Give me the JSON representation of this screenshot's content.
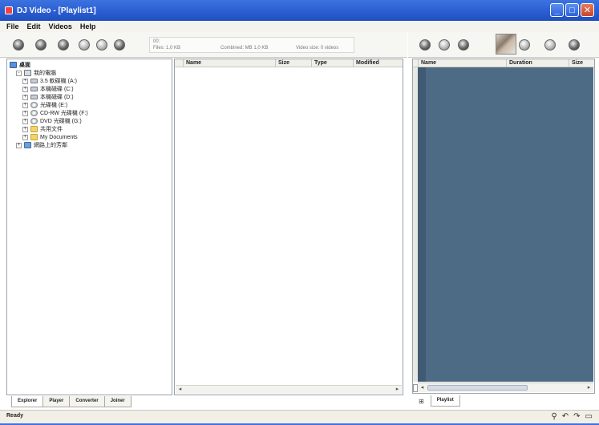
{
  "window": {
    "title": "DJ Video - [Playlist1]",
    "controls": {
      "minimize": "_",
      "maximize": "□",
      "close": "✕"
    }
  },
  "menu": [
    "File",
    "Edit",
    "Videos",
    "Help"
  ],
  "status_panel": {
    "line1": "00:",
    "line2": "Files: 1,0 KB",
    "line3": "Combined: MB 1,0 KB",
    "line4": "Video size: 0 videos"
  },
  "tree": [
    {
      "label": "桌面",
      "icon": "desktop-icon",
      "indent": 0,
      "expander": ""
    },
    {
      "label": "我的電腦",
      "icon": "computer-icon",
      "indent": 1,
      "expander": "-"
    },
    {
      "label": "3.5 軟碟機 (A:)",
      "icon": "floppy-icon",
      "indent": 2,
      "expander": "+"
    },
    {
      "label": "本機磁碟 (C:)",
      "icon": "drive-icon",
      "indent": 2,
      "expander": "+"
    },
    {
      "label": "本機磁碟 (D:)",
      "icon": "drive-icon",
      "indent": 2,
      "expander": "+"
    },
    {
      "label": "光碟機 (E:)",
      "icon": "cd-icon",
      "indent": 2,
      "expander": "+"
    },
    {
      "label": "CD-RW 光碟機 (F:)",
      "icon": "cd-icon",
      "indent": 2,
      "expander": "+"
    },
    {
      "label": "DVD 光碟機 (G:)",
      "icon": "cd-icon",
      "indent": 2,
      "expander": "+"
    },
    {
      "label": "共用文件",
      "icon": "folder-icon",
      "indent": 2,
      "expander": "+"
    },
    {
      "label": "My Documents",
      "icon": "folder-icon",
      "indent": 2,
      "expander": "+"
    },
    {
      "label": "網路上的芳鄰",
      "icon": "network-icon",
      "indent": 1,
      "expander": "+"
    }
  ],
  "files_columns": [
    "Name",
    "Size",
    "Type",
    "Modified"
  ],
  "playlist_columns": [
    "Name",
    "Duration",
    "Size"
  ],
  "left_tabs": [
    "Explorer",
    "Player",
    "Converter",
    "Joiner"
  ],
  "right_tab": "Playlist",
  "status": "Ready",
  "colors": {
    "titlebar": "#2a5cd0",
    "playlist_bg": "#4d6b85"
  }
}
